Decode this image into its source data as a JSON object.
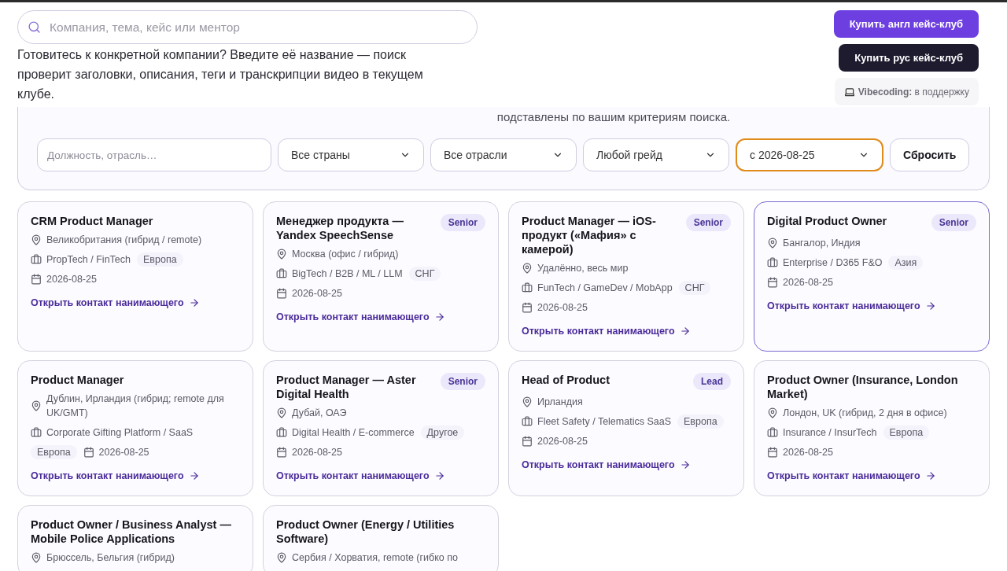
{
  "search": {
    "placeholder": "Компания, тема, кейс или ментор"
  },
  "hint": "Готовитесь к конкретной компании? Введите её название — поиск проверит заголовки, описания, теги и транскрипции видео в текущем клубе.",
  "header_buttons": [
    {
      "label": "Купить англ кейс-клуб",
      "kind": "primary"
    },
    {
      "label": "Купить рус кейс-клуб",
      "kind": "dark"
    }
  ],
  "support_chip": {
    "text": "**Vibecoding:** в поддержку"
  },
  "filters": {
    "note": "подставлены по вашим критериям поиска.",
    "keyword": {
      "placeholder": "Должность, отрасль…"
    },
    "selects": [
      {
        "value": "Все страны",
        "focused": false
      },
      {
        "value": "Все отрасли",
        "focused": false
      },
      {
        "value": "Любой грейд",
        "focused": false
      },
      {
        "value": "с 2026-08-25",
        "focused": true
      }
    ],
    "reset_button": "Сбросить"
  },
  "jobs": [
    {
      "title": "CRM Product Manager",
      "location": "Великобритания (гибрид / remote)",
      "industry": "PropTech / FinTech",
      "region": "Европа",
      "date": "2026-08-25",
      "link": "Открыть контакт нанимающего",
      "highlighted": false
    },
    {
      "title": "Менеджер продукта — Yandex SpeechSense",
      "grade": "Senior",
      "location": "Москва (офис / гибрид)",
      "industry": "BigTech / B2B / ML / LLM",
      "region": "СНГ",
      "date": "2026-08-25",
      "link": "Открыть контакт нанимающего",
      "highlighted": false
    },
    {
      "title": "Product Manager — iOS-продукт («Мафия» с камерой)",
      "grade": "Senior",
      "location": "Удалённо, весь мир",
      "industry": "FunTech / GameDev / MobApp",
      "region": "СНГ",
      "date": "2026-08-25",
      "link": "Открыть контакт нанимающего",
      "highlighted": false
    },
    {
      "title": "Digital Product Owner",
      "grade": "Senior",
      "location": "Бангалор, Индия",
      "industry": "Enterprise / D365 F&O",
      "region": "Азия",
      "date": "2026-08-25",
      "link": "Открыть контакт нанимающего",
      "highlighted": true
    },
    {
      "title": "Product Manager",
      "location": "Дублин, Ирландия (гибрид; remote для UK/GMT)",
      "industry": "Corporate Gifting Platform / SaaS",
      "region": "Европа",
      "date": "2026-08-25",
      "link": "Открыть контакт нанимающего",
      "highlighted": false
    },
    {
      "title": "Product Manager — Aster Digital Health",
      "grade": "Senior",
      "location": "Дубай, ОАЭ",
      "industry": "Digital Health / E-commerce",
      "region": "Другое",
      "date": "2026-08-25",
      "link": "Открыть контакт нанимающего",
      "highlighted": false
    },
    {
      "title": "Head of Product",
      "grade": "Lead",
      "location": "Ирландия",
      "industry": "Fleet Safety / Telematics SaaS",
      "region": "Европа",
      "date": "2026-08-25",
      "link": "Открыть контакт нанимающего",
      "highlighted": false
    },
    {
      "title": "Product Owner (Insurance, London Market)",
      "location": "Лондон, UK (гибрид, 2 дня в офисе)",
      "industry": "Insurance / InsurTech",
      "region": "Европа",
      "date": "2026-08-25",
      "link": "Открыть контакт нанимающего",
      "highlighted": false
    },
    {
      "title": "Product Owner / Business Analyst — Mobile Police Applications",
      "location": "Брюссель, Бельгия (гибрид)",
      "highlighted": false
    },
    {
      "title": "Product Owner (Energy / Utilities Software)",
      "location": "Сербия / Хорватия, remote (гибко по",
      "highlighted": false
    }
  ]
}
